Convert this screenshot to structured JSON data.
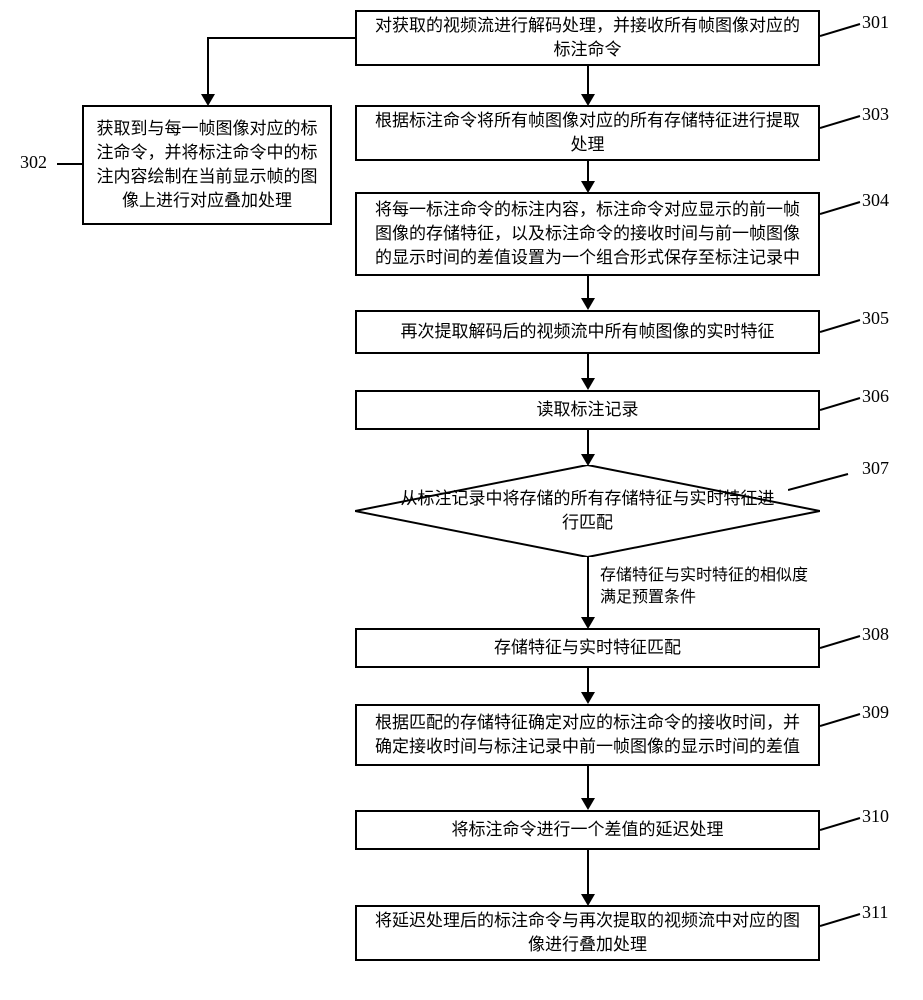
{
  "nodes": {
    "n301": {
      "text": "对获取的视频流进行解码处理，并接收所有帧图像对应的标注命令",
      "ref": "301"
    },
    "n302": {
      "text": "获取到与每一帧图像对应的标注命令，并将标注命令中的标注内容绘制在当前显示帧的图像上进行对应叠加处理",
      "ref": "302"
    },
    "n303": {
      "text": "根据标注命令将所有帧图像对应的所有存储特征进行提取处理",
      "ref": "303"
    },
    "n304": {
      "text": "将每一标注命令的标注内容，标注命令对应显示的前一帧图像的存储特征，以及标注命令的接收时间与前一帧图像的显示时间的差值设置为一个组合形式保存至标注记录中",
      "ref": "304"
    },
    "n305": {
      "text": "再次提取解码后的视频流中所有帧图像的实时特征",
      "ref": "305"
    },
    "n306": {
      "text": "读取标注记录",
      "ref": "306"
    },
    "n307": {
      "text": "从标注记录中将存储的所有存储特征与实时特征进行匹配",
      "ref": "307"
    },
    "n308": {
      "text": "存储特征与实时特征匹配",
      "ref": "308"
    },
    "n309": {
      "text": "根据匹配的存储特征确定对应的标注命令的接收时间，并确定接收时间与标注记录中前一帧图像的显示时间的差值",
      "ref": "309"
    },
    "n310": {
      "text": "将标注命令进行一个差值的延迟处理",
      "ref": "310"
    },
    "n311": {
      "text": "将延迟处理后的标注命令与再次提取的视频流中对应的图像进行叠加处理",
      "ref": "311"
    }
  },
  "edgeLabels": {
    "e307_308": "存储特征与实时特征的相似度满足预置条件"
  },
  "chart_data": {
    "type": "flowchart",
    "title": "",
    "nodes": [
      {
        "id": "301",
        "shape": "process",
        "label": "对获取的视频流进行解码处理，并接收所有帧图像对应的标注命令"
      },
      {
        "id": "302",
        "shape": "process",
        "label": "获取到与每一帧图像对应的标注命令，并将标注命令中的标注内容绘制在当前显示帧的图像上进行对应叠加处理"
      },
      {
        "id": "303",
        "shape": "process",
        "label": "根据标注命令将所有帧图像对应的所有存储特征进行提取处理"
      },
      {
        "id": "304",
        "shape": "process",
        "label": "将每一标注命令的标注内容，标注命令对应显示的前一帧图像的存储特征，以及标注命令的接收时间与前一帧图像的显示时间的差值设置为一个组合形式保存至标注记录中"
      },
      {
        "id": "305",
        "shape": "process",
        "label": "再次提取解码后的视频流中所有帧图像的实时特征"
      },
      {
        "id": "306",
        "shape": "process",
        "label": "读取标注记录"
      },
      {
        "id": "307",
        "shape": "decision",
        "label": "从标注记录中将存储的所有存储特征与实时特征进行匹配"
      },
      {
        "id": "308",
        "shape": "process",
        "label": "存储特征与实时特征匹配"
      },
      {
        "id": "309",
        "shape": "process",
        "label": "根据匹配的存储特征确定对应的标注命令的接收时间，并确定接收时间与标注记录中前一帧图像的显示时间的差值"
      },
      {
        "id": "310",
        "shape": "process",
        "label": "将标注命令进行一个差值的延迟处理"
      },
      {
        "id": "311",
        "shape": "process",
        "label": "将延迟处理后的标注命令与再次提取的视频流中对应的图像进行叠加处理"
      }
    ],
    "edges": [
      {
        "from": "301",
        "to": "302",
        "label": ""
      },
      {
        "from": "301",
        "to": "303",
        "label": ""
      },
      {
        "from": "303",
        "to": "304",
        "label": ""
      },
      {
        "from": "304",
        "to": "305",
        "label": ""
      },
      {
        "from": "305",
        "to": "306",
        "label": ""
      },
      {
        "from": "306",
        "to": "307",
        "label": ""
      },
      {
        "from": "307",
        "to": "308",
        "label": "存储特征与实时特征的相似度满足预置条件"
      },
      {
        "from": "308",
        "to": "309",
        "label": ""
      },
      {
        "from": "309",
        "to": "310",
        "label": ""
      },
      {
        "from": "310",
        "to": "311",
        "label": ""
      }
    ]
  }
}
